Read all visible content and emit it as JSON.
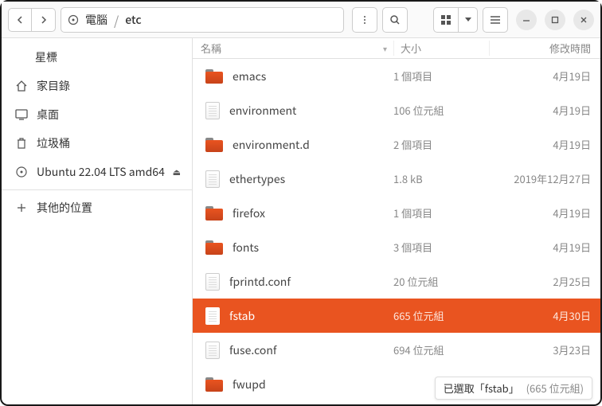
{
  "path": {
    "root_label": "電腦",
    "segment": "etc"
  },
  "sidebar": {
    "starred": "星標",
    "home": "家目錄",
    "desktop": "桌面",
    "trash": "垃圾桶",
    "disk": "Ubuntu 22.04 LTS amd64",
    "other": "其他的位置"
  },
  "columns": {
    "name": "名稱",
    "size": "大小",
    "date": "修改時間"
  },
  "files": [
    {
      "name": "emacs",
      "type": "folder",
      "size": "1 個項目",
      "date": "4月19日"
    },
    {
      "name": "environment",
      "type": "file",
      "size": "106 位元組",
      "date": "4月19日"
    },
    {
      "name": "environment.d",
      "type": "folder",
      "size": "2 個項目",
      "date": "4月19日"
    },
    {
      "name": "ethertypes",
      "type": "file",
      "size": "1.8 kB",
      "date": "2019年12月27日"
    },
    {
      "name": "firefox",
      "type": "folder",
      "size": "1 個項目",
      "date": "4月19日"
    },
    {
      "name": "fonts",
      "type": "folder",
      "size": "3 個項目",
      "date": "4月19日"
    },
    {
      "name": "fprintd.conf",
      "type": "file",
      "size": "20 位元組",
      "date": "2月25日"
    },
    {
      "name": "fstab",
      "type": "file",
      "size": "665 位元組",
      "date": "4月30日",
      "selected": true
    },
    {
      "name": "fuse.conf",
      "type": "file",
      "size": "694 位元組",
      "date": "3月23日"
    },
    {
      "name": "fwupd",
      "type": "folder",
      "size": "",
      "date": ""
    }
  ],
  "status": {
    "text": "已選取「fstab」",
    "size": "(665 位元組)"
  }
}
